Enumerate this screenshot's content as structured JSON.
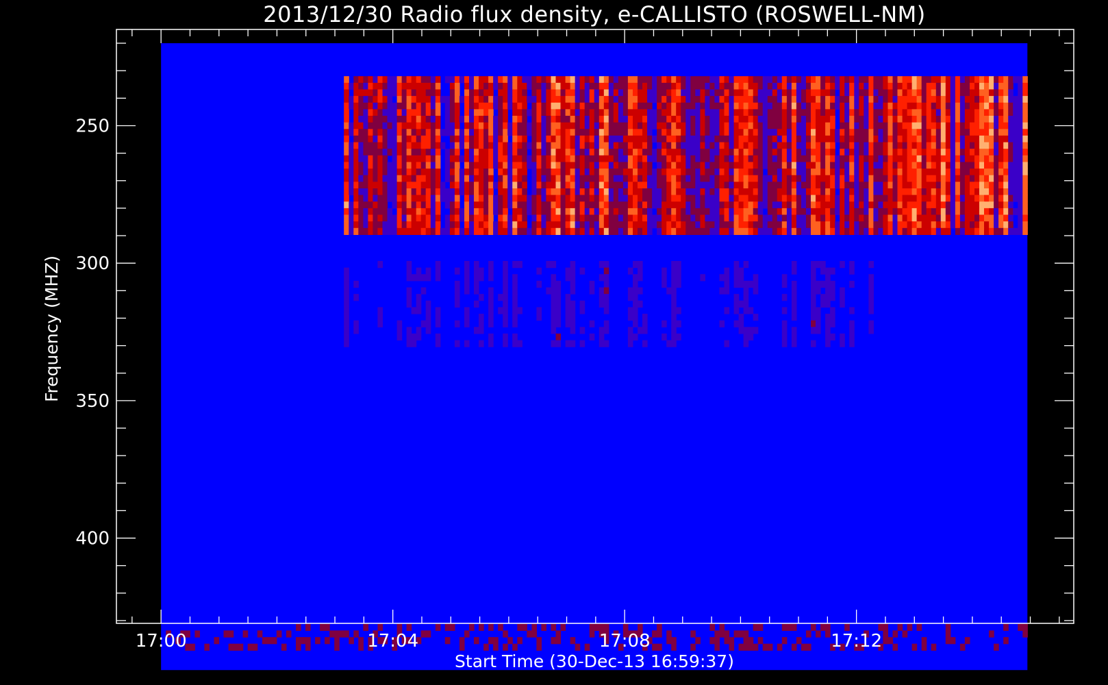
{
  "chart_data": {
    "type": "heatmap",
    "title": "2013/12/30  Radio flux density, e-CALLISTO (ROSWELL-NM)",
    "xlabel": "Start Time (30-Dec-13 16:59:37)",
    "ylabel": "Frequency (MHZ)",
    "x_tick_labels": [
      "17:00",
      "17:04",
      "17:08",
      "17:12"
    ],
    "x_tick_values_min": [
      0,
      4,
      8,
      12
    ],
    "xlim_min": [
      -0.77,
      15.75
    ],
    "y_tick_labels": [
      "250",
      "300",
      "350",
      "400"
    ],
    "y_tick_values": [
      250,
      300,
      350,
      400
    ],
    "ylim": [
      431,
      215
    ],
    "data_extent": {
      "t_min": [
        0,
        14.95
      ],
      "freq_mhz": [
        220,
        448
      ]
    },
    "colormap": [
      "#000066",
      "#0000ff",
      "#3a00c8",
      "#800040",
      "#cc0000",
      "#ff2000",
      "#ff6020",
      "#ffb070"
    ],
    "burst_regions": [
      {
        "t_min": [
          3.1,
          14.95
        ],
        "freq_mhz": [
          232,
          288
        ],
        "intensity": 0.85
      },
      {
        "t_min": [
          3.1,
          12.3
        ],
        "freq_mhz": [
          298,
          328
        ],
        "intensity": 0.35
      },
      {
        "t_min": [
          12.6,
          14.95
        ],
        "freq_mhz": [
          232,
          285
        ],
        "intensity": 0.95
      }
    ],
    "grid": false,
    "legend": "none"
  }
}
